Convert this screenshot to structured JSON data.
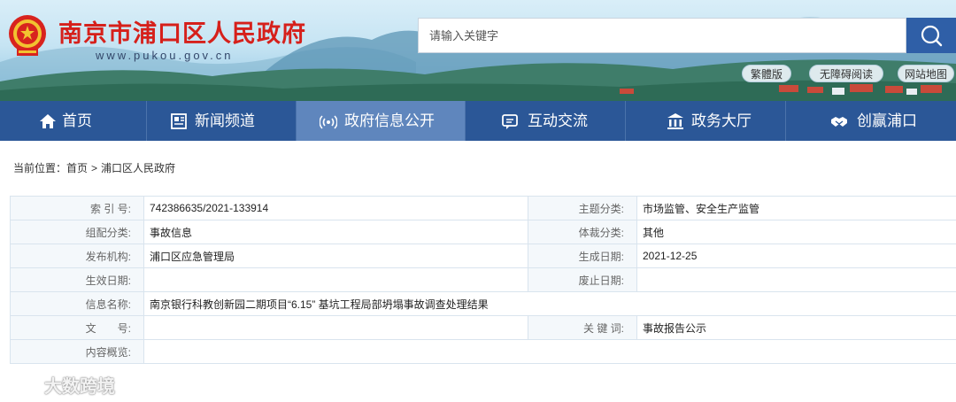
{
  "header": {
    "site_title": "南京市浦口区人民政府",
    "site_url": "www.pukou.gov.cn",
    "search_placeholder": "请输入关键字",
    "quick_links": [
      "繁體版",
      "无障碍阅读",
      "网站地图"
    ]
  },
  "nav": {
    "items": [
      {
        "label": "首页",
        "icon": "home-icon"
      },
      {
        "label": "新闻频道",
        "icon": "newspaper-icon"
      },
      {
        "label": "政府信息公开",
        "icon": "broadcast-icon",
        "active": true
      },
      {
        "label": "互动交流",
        "icon": "chat-icon"
      },
      {
        "label": "政务大厅",
        "icon": "building-icon"
      },
      {
        "label": "创赢浦口",
        "icon": "handshake-icon"
      }
    ]
  },
  "breadcrumb": {
    "prefix": "当前位置：",
    "items": [
      "首页",
      "浦口区人民政府"
    ],
    "separator": ">"
  },
  "info_table": {
    "index_label": "索 引 号:",
    "index_value": "742386635/2021-133914",
    "topic_label": "主题分类:",
    "topic_value": "市场监管、安全生产监管",
    "org_cat_label": "组配分类:",
    "org_cat_value": "事故信息",
    "genre_label": "体裁分类:",
    "genre_value": "其他",
    "publisher_label": "发布机构:",
    "publisher_value": "浦口区应急管理局",
    "created_label": "生成日期:",
    "created_value": "2021-12-25",
    "effective_label": "生效日期:",
    "effective_value": "",
    "expired_label": "废止日期:",
    "expired_value": "",
    "name_label": "信息名称:",
    "name_value": "南京银行科教创新园二期项目“6.15” 基坑工程局部坍塌事故调查处理结果",
    "docno_label": "文　　号:",
    "docno_value": "",
    "keywords_label": "关 键 词:",
    "keywords_value": "事故报告公示",
    "summary_label": "内容概览:",
    "summary_value": ""
  },
  "watermark": {
    "text": "大数跨境"
  },
  "colors": {
    "nav_bg": "#2b5797",
    "nav_active": "#5f86bd",
    "title_red": "#d6201b",
    "search_btn": "#2f5fa7"
  }
}
